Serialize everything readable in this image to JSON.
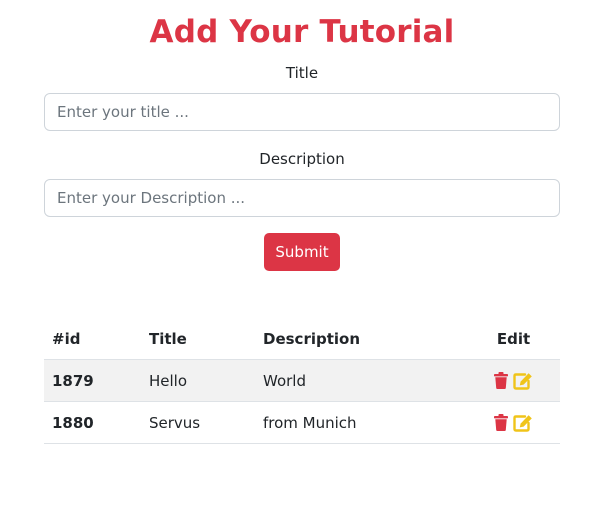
{
  "header": {
    "title": "Add Your Tutorial"
  },
  "form": {
    "title_label": "Title",
    "title_placeholder": "Enter your title ...",
    "title_value": "",
    "description_label": "Description",
    "description_placeholder": "Enter your Description ...",
    "description_value": "",
    "submit_label": "Submit"
  },
  "table": {
    "columns": [
      "#id",
      "Title",
      "Description",
      "Edit"
    ],
    "rows": [
      {
        "id": "1879",
        "title": "Hello",
        "description": "World"
      },
      {
        "id": "1880",
        "title": "Servus",
        "description": "from Munich"
      }
    ]
  },
  "icons": {
    "delete": "trash-icon",
    "edit": "edit-icon"
  },
  "colors": {
    "accent": "#dc3545",
    "edit_icon": "#f0c419",
    "row_stripe": "#f2f2f2"
  }
}
